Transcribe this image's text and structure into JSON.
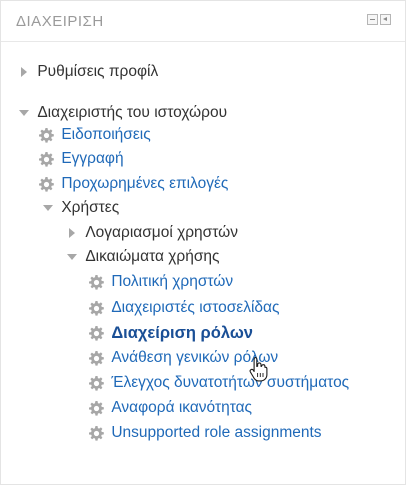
{
  "block": {
    "title": "ΔΙΑΧΕΙΡΙΣΗ",
    "controls": [
      "hide-icon",
      "dock-icon"
    ]
  },
  "tree": {
    "profile_settings": "Ρυθμίσεις προφίλ",
    "site_admin": "Διαχειριστής του ιστοχώρου",
    "notifications": "Ειδοποιήσεις",
    "registration": "Εγγραφή",
    "advanced_features": "Προχωρημένες επιλογές",
    "users": "Χρήστες",
    "accounts": "Λογαριασμοί χρηστών",
    "permissions": "Δικαιώματα χρήσης",
    "user_policies": "Πολιτική χρηστών",
    "site_admins": "Διαχειριστές ιστοσελίδας",
    "define_roles": "Διαχείριση ρόλων",
    "assign_system_roles": "Ανάθεση γενικών ρόλων",
    "check_system_permissions": "Έλεγχος δυνατοτήτων συστήματος",
    "capability_report": "Αναφορά ικανότητας",
    "unsupported_roles": "Unsupported role assignments"
  },
  "colors": {
    "link": "#1f69b8",
    "active_link": "#1a4f96",
    "text": "#333333",
    "muted": "#9a9a9a",
    "icon": "#a7a7a7"
  }
}
